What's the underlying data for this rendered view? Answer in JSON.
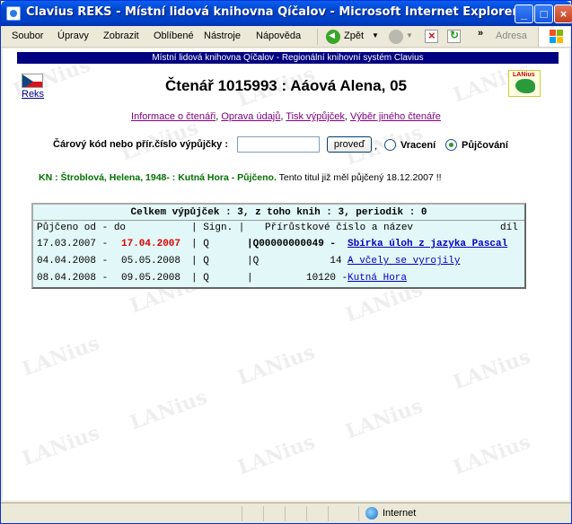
{
  "window": {
    "title": "Clavius REKS - Místní lidová knihovna Qíčalov - Microsoft Internet Explorer",
    "min_label": "_",
    "max_label": "□",
    "close_label": "×"
  },
  "menu": [
    "Soubor",
    "Úpravy",
    "Zobrazit",
    "Oblíbené",
    "Nástroje",
    "Nápověda"
  ],
  "toolbar": {
    "back_label": "Zpět",
    "chevron": "»",
    "address_label": "Adresa"
  },
  "page": {
    "banner": "Místní lidová knihovna Qíčalov - Regionální knihovní systém Clavius",
    "reks_link": "Reks",
    "logo_text": "LANius",
    "watermark": "LANius",
    "title": "Čtenář 1015993 : Aáová Alena, 05",
    "links": [
      "Informace o čtenáři",
      "Oprava údajů",
      "Tisk výpůjček",
      "Výběr jiného čtenáře"
    ],
    "barcode_label": "Čárový kód nebo přír.číslo výpůjčky :",
    "barcode_value": "",
    "submit_label": "proveď",
    "comma": ",",
    "radio_return": "Vracení",
    "radio_lend": "Půjčování",
    "message_kn": "KN : Štroblová, Helena, 1948- : Kutná Hora - Půjčeno.",
    "message_note": "Tento titul již měl půjčený 18.12.2007 !!"
  },
  "loans": {
    "summary": "Celkem výpůjček : 3, z toho knih : 3, periodik : 0",
    "header": {
      "lent": "Půjčeno od - do",
      "sig": "| Sign. |",
      "acc": "Přírůstkové číslo a název",
      "part": "díl"
    },
    "rows": [
      {
        "from": "17.03.2007 -",
        "to": "17.04.2007",
        "overdue": true,
        "sig": "| Q",
        "acc": "|Q00000000049 -",
        "title": "Sbírka úloh z jazyka Pascal"
      },
      {
        "from": "04.04.2008 -",
        "to": "05.05.2008",
        "overdue": false,
        "sig": "| Q",
        "acc": "|Q            14 -",
        "title": "A včely se vyrojily"
      },
      {
        "from": "08.04.2008 -",
        "to": "09.05.2008",
        "overdue": false,
        "sig": "| Q",
        "acc": "|         10120 -",
        "title": "Kutná Hora"
      }
    ]
  },
  "status": {
    "zone": "Internet"
  },
  "colors": {
    "banner": "#000080",
    "overdue": "#e00000",
    "message": "#007000",
    "table_bg": "#e2f7f7"
  }
}
